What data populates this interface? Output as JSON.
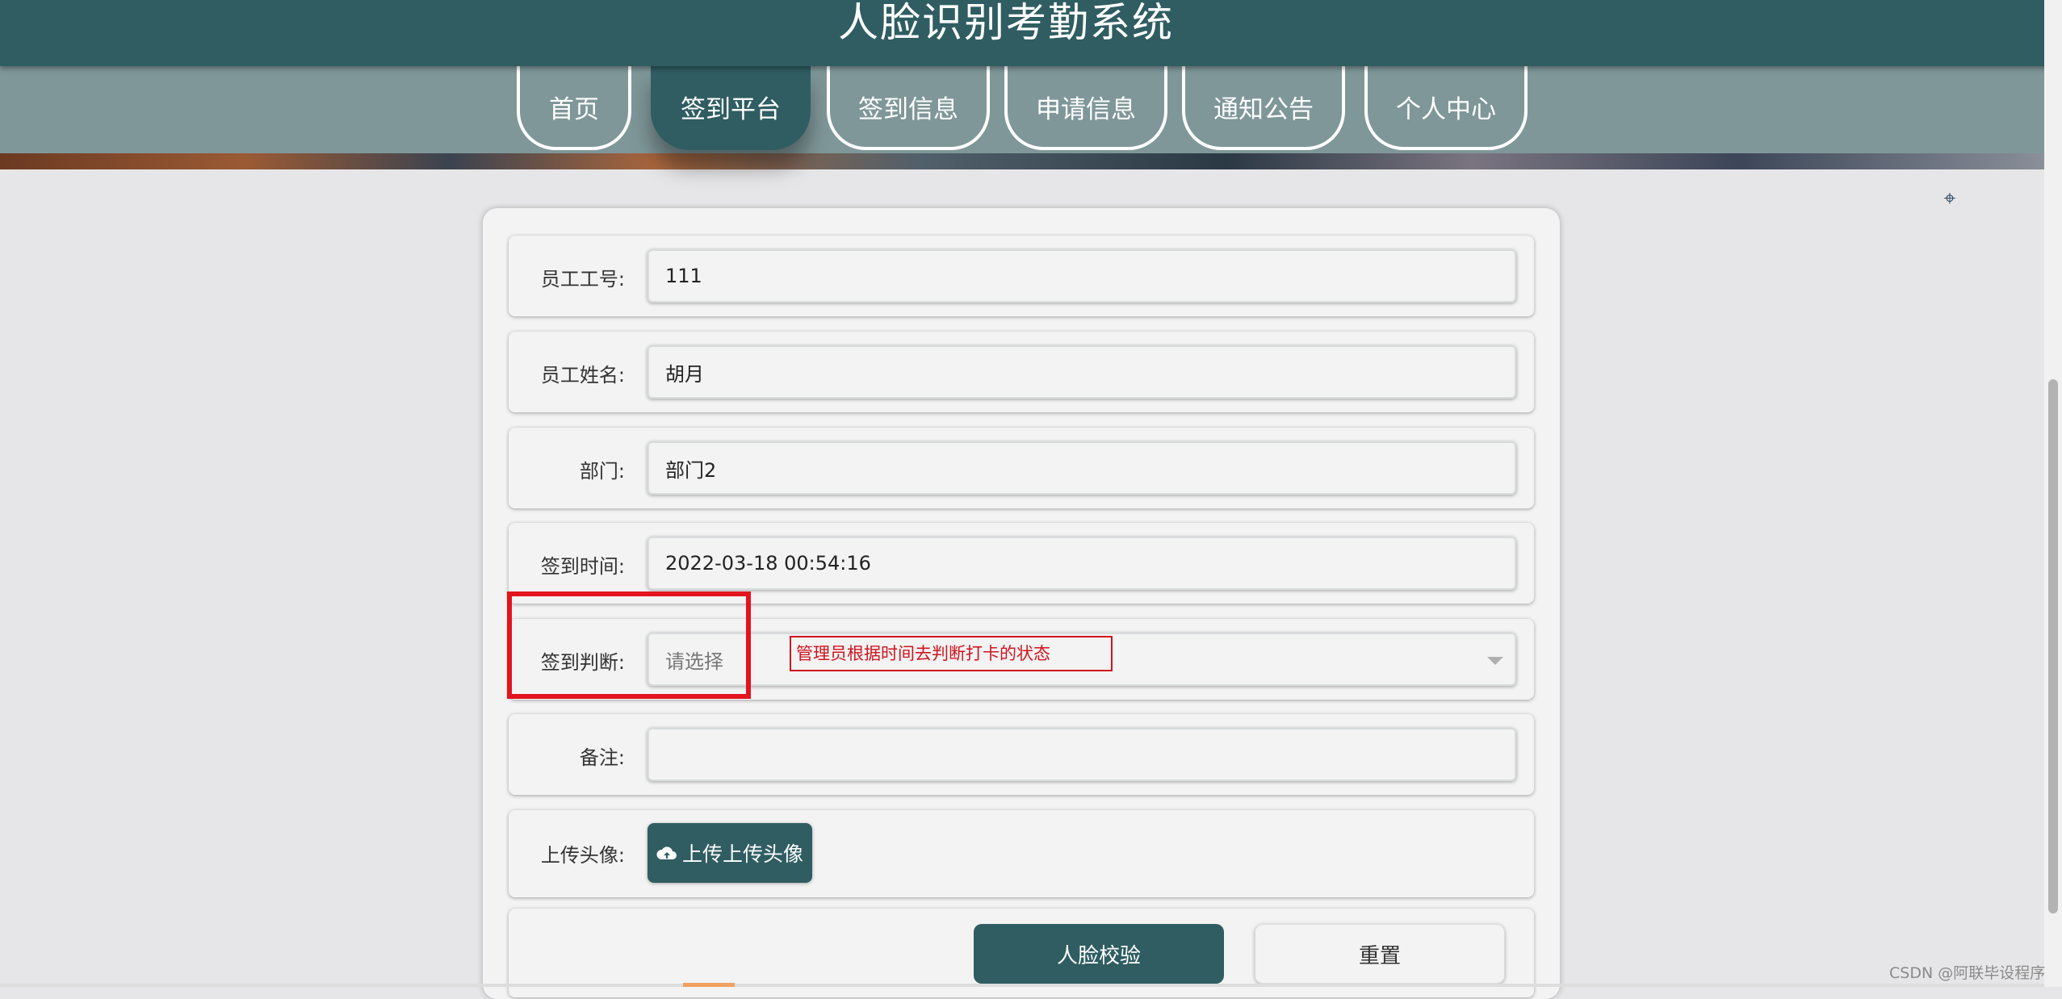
{
  "header": {
    "title": "人脸识别考勤系统"
  },
  "nav": {
    "tabs": [
      {
        "label": "首页",
        "active": false
      },
      {
        "label": "签到平台",
        "active": true
      },
      {
        "label": "签到信息",
        "active": false
      },
      {
        "label": "申请信息",
        "active": false
      },
      {
        "label": "通知公告",
        "active": false
      },
      {
        "label": "个人中心",
        "active": false
      }
    ]
  },
  "form": {
    "employee_id": {
      "label": "员工工号:",
      "value": "111"
    },
    "employee_name": {
      "label": "员工姓名:",
      "value": "胡月"
    },
    "department": {
      "label": "部门:",
      "value": "部门2"
    },
    "checkin_time": {
      "label": "签到时间:",
      "value": "2022-03-18 00:54:16"
    },
    "checkin_judgement": {
      "label": "签到判断:",
      "placeholder": "请选择"
    },
    "remark": {
      "label": "备注:",
      "value": ""
    },
    "avatar": {
      "label": "上传头像:",
      "button_label": "上传上传头像",
      "icon": "cloud-upload-icon"
    }
  },
  "annotation": {
    "note": "管理员根据时间去判断打卡的状态",
    "color": "#d0141e"
  },
  "actions": {
    "face_verify_label": "人脸校验",
    "reset_label": "重置"
  },
  "watermark": "CSDN @阿联毕设程序",
  "colors": {
    "primary": "#2f5d62",
    "nav_band": "#7f9799",
    "background": "#e6e6e8",
    "highlight": "#e2141e"
  }
}
